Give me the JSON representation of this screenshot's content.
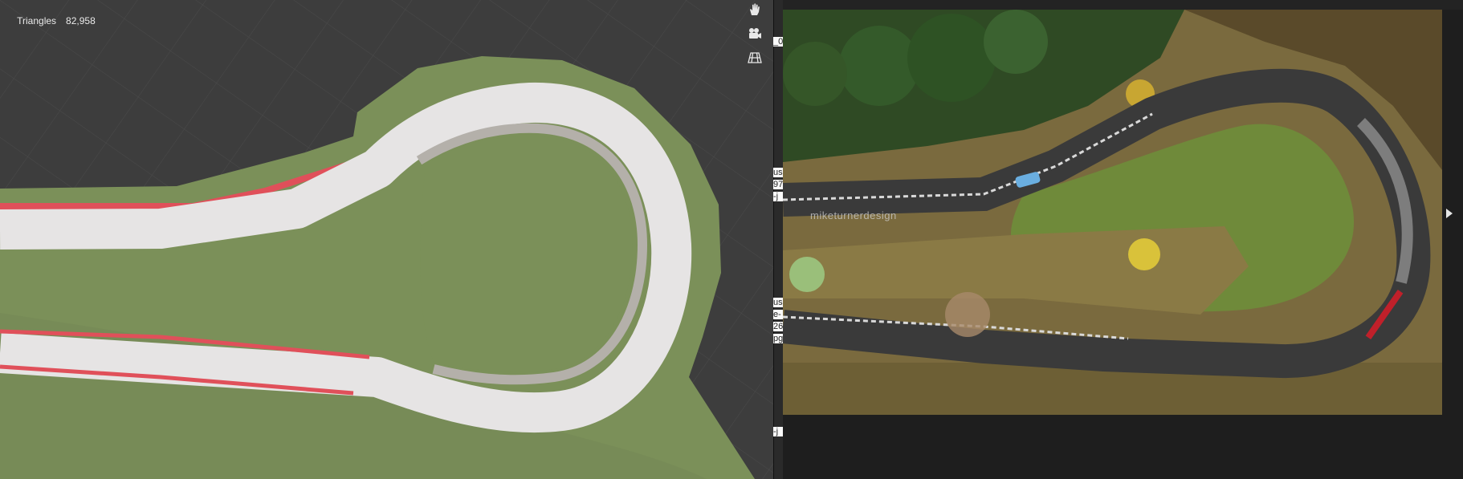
{
  "viewport": {
    "stats_label": "Triangles",
    "stats_value": "82,958",
    "tools": [
      {
        "name": "pan-hand-icon"
      },
      {
        "name": "camera-icon"
      },
      {
        "name": "grid-plane-icon"
      }
    ],
    "colors": {
      "background": "#3d3d3d",
      "grass": "#7b9059",
      "road": "#e6e4e4",
      "curb": "#e0505a",
      "runoff": "#b4b0aa"
    }
  },
  "sidebar_peek": [
    "_0",
    "us",
    "97",
    "-j",
    "us",
    "e-",
    "26",
    "pg",
    "-j"
  ],
  "viewer": {
    "watermark": "miketurnerdesign",
    "next_icon": "chevron-right-icon"
  }
}
